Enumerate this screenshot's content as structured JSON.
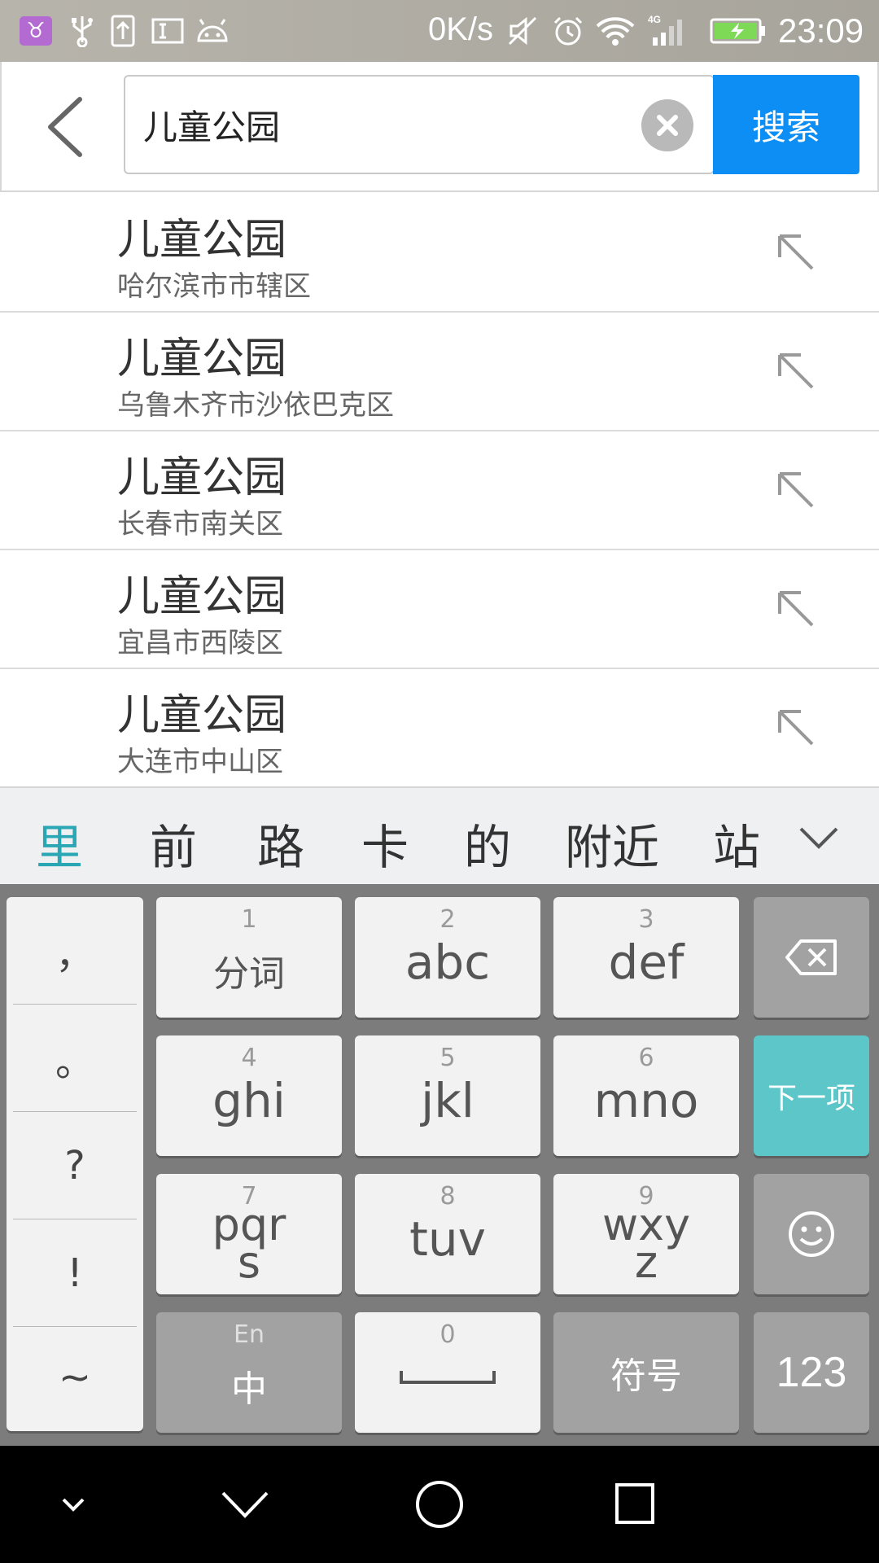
{
  "status_bar": {
    "network_speed": "0K/s",
    "network_type": "4G",
    "time": "23:09",
    "icons": [
      "app-notification-icon",
      "usb-icon",
      "upload-icon",
      "input-method-icon",
      "android-debug-icon",
      "mute-icon",
      "alarm-icon",
      "wifi-icon",
      "signal-icon",
      "battery-charging-icon"
    ]
  },
  "search": {
    "query": "儿童公园",
    "button_label": "搜索"
  },
  "suggestions": [
    {
      "title": "儿童公园",
      "subtitle": "哈尔滨市市辖区"
    },
    {
      "title": "儿童公园",
      "subtitle": "乌鲁木齐市沙依巴克区"
    },
    {
      "title": "儿童公园",
      "subtitle": "长春市南关区"
    },
    {
      "title": "儿童公园",
      "subtitle": "宜昌市西陵区"
    },
    {
      "title": "儿童公园",
      "subtitle": "大连市中山区"
    }
  ],
  "ime": {
    "candidates": [
      "里",
      "前",
      "路",
      "卡",
      "的",
      "附近",
      "站"
    ],
    "punctuation": [
      "，",
      "。",
      "?",
      "!",
      "~"
    ],
    "keys": {
      "k1": {
        "num": "1",
        "label": "分词"
      },
      "k2": {
        "num": "2",
        "label": "abc"
      },
      "k3": {
        "num": "3",
        "label": "def"
      },
      "k4": {
        "num": "4",
        "label": "ghi"
      },
      "k5": {
        "num": "5",
        "label": "jkl"
      },
      "k6": {
        "num": "6",
        "label": "mno"
      },
      "k7": {
        "num": "7",
        "label_line1": "pqr",
        "label_line2": "s"
      },
      "k8": {
        "num": "8",
        "label": "tuv"
      },
      "k9": {
        "num": "9",
        "label_line1": "wxy",
        "label_line2": "z"
      },
      "k0": {
        "num": "0"
      },
      "lang": {
        "small": "En",
        "label": "中"
      },
      "next": {
        "label": "下一项"
      },
      "symbol": {
        "label": "符号"
      },
      "numeric": {
        "label": "123"
      }
    },
    "accent_color": "#5cc6c9"
  },
  "colors": {
    "search_button": "#0d8ef5",
    "candidate_highlight": "#2aa7b4"
  }
}
